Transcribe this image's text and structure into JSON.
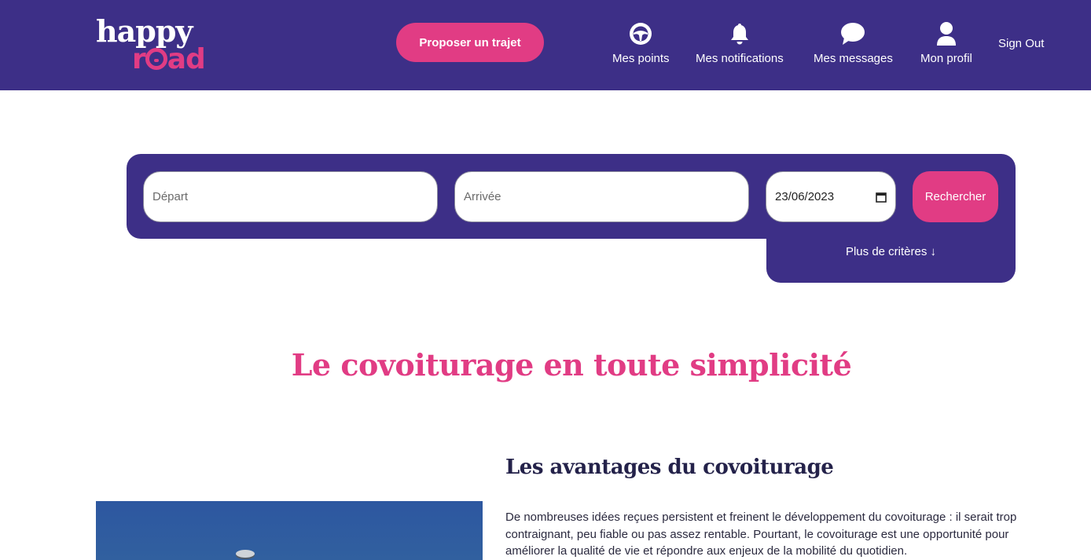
{
  "colors": {
    "header_bg": "#3d2f87",
    "accent": "#e13c84",
    "heading_dark": "#24224a"
  },
  "header": {
    "logo": {
      "line1": "happy",
      "line2": "road"
    },
    "propose_label": "Proposer un trajet",
    "nav": [
      {
        "icon": "steering-wheel-icon",
        "label": "Mes points"
      },
      {
        "icon": "bell-icon",
        "label": "Mes notifications"
      },
      {
        "icon": "chat-bubble-icon",
        "label": "Mes messages"
      },
      {
        "icon": "user-icon",
        "label": "Mon profil"
      }
    ],
    "signout_label": "Sign Out"
  },
  "search": {
    "departure_placeholder": "Départ",
    "arrival_placeholder": "Arrivée",
    "date_value": "23/06/2023",
    "search_label": "Rechercher",
    "more_criteria_label": "Plus de critères ↓"
  },
  "main": {
    "title": "Le covoiturage en toute simplicité",
    "section_title": "Les avantages du covoiturage",
    "section_text": "De nombreuses idées reçues persistent et freinent le développement du covoiturage : il serait trop contraignant, peu fiable ou pas assez rentable. Pourtant, le covoiturage est une opportunité pour améliorer la qualité de vie et répondre aux enjeux de la mobilité du quotidien."
  }
}
